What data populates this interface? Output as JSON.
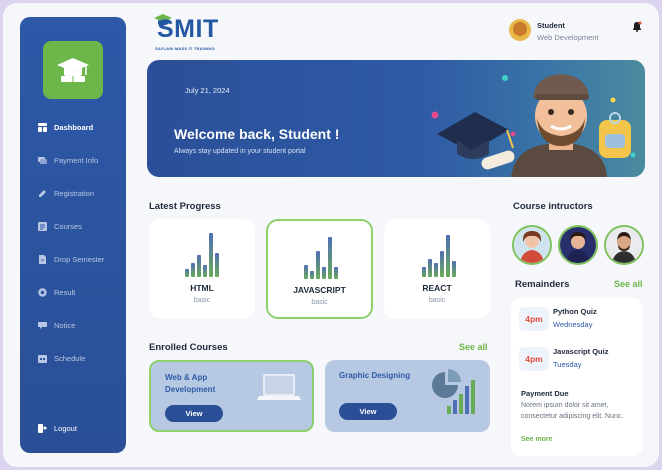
{
  "brand": {
    "name": "SMIT",
    "tagline": "SAYLANI MASS IT TRAINING"
  },
  "sidebar": {
    "items": [
      {
        "label": "Dashboard",
        "icon": "dashboard-icon",
        "active": true
      },
      {
        "label": "Payment Info",
        "icon": "payment-icon"
      },
      {
        "label": "Registration",
        "icon": "pencil-icon"
      },
      {
        "label": "Courses",
        "icon": "courses-icon"
      },
      {
        "label": "Drop Semester",
        "icon": "document-icon"
      },
      {
        "label": "Result",
        "icon": "result-icon"
      },
      {
        "label": "Notice",
        "icon": "notice-icon"
      },
      {
        "label": "Schedule",
        "icon": "schedule-icon"
      }
    ],
    "logout": "Logout"
  },
  "profile": {
    "name": "Student",
    "role": "Web Development"
  },
  "banner": {
    "date": "July  21, 2024",
    "welcome": "Welcome back, Student !",
    "subtitle": "Always stay updated in your student portal"
  },
  "progress": {
    "title": "Latest Progress",
    "cards": [
      {
        "title": "HTML",
        "level": "basic"
      },
      {
        "title": "JAVASCRIPT",
        "level": "basic"
      },
      {
        "title": "REACT",
        "level": "basic"
      }
    ]
  },
  "enrolled": {
    "title": "Enrolled Courses",
    "see_all": "See all",
    "courses": [
      {
        "title": "Web & App Development",
        "button": "View"
      },
      {
        "title": "Graphic Designing",
        "button": "View"
      }
    ]
  },
  "instructors": {
    "title": "Course intructors"
  },
  "reminders": {
    "title": "Remainders",
    "see_all": "See all",
    "items": [
      {
        "time": "4pm",
        "title": "Python Quiz",
        "day": "Wednesday"
      },
      {
        "time": "4pm",
        "title": "Javascript Quiz",
        "day": "Tuesday"
      }
    ],
    "payment": {
      "title": "Payment Due",
      "body": "Norem ipsum dolor sit amet, consectetur adipiscing elit. Nunc.",
      "more": "See more"
    }
  },
  "colors": {
    "primary": "#2a4f96",
    "accent": "#6cb64a",
    "alert": "#e14b37"
  }
}
